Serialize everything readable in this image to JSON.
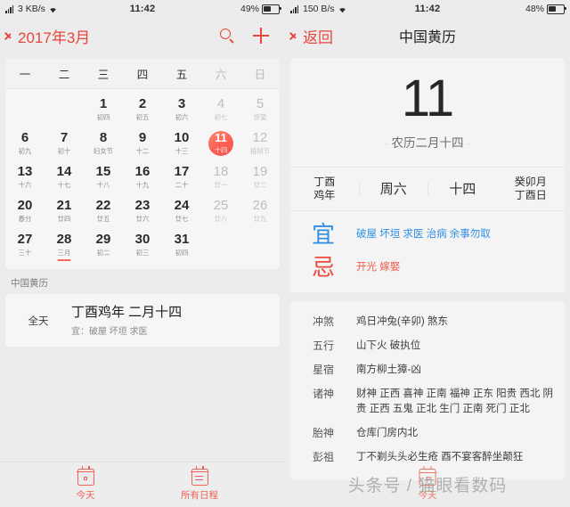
{
  "left": {
    "status": {
      "network": "3 KB/s",
      "time": "11:42",
      "battery": "49%"
    },
    "nav": {
      "title": "2017年3月",
      "search_icon": "search-icon",
      "add_icon": "plus-icon"
    },
    "weekdays": [
      {
        "label": "一",
        "weekend": false
      },
      {
        "label": "二",
        "weekend": false
      },
      {
        "label": "三",
        "weekend": false
      },
      {
        "label": "四",
        "weekend": false
      },
      {
        "label": "五",
        "weekend": false
      },
      {
        "label": "六",
        "weekend": true
      },
      {
        "label": "日",
        "weekend": true
      }
    ],
    "weeks": [
      [
        {
          "num": "",
          "lunar": "",
          "empty": true
        },
        {
          "num": "",
          "lunar": "",
          "empty": true
        },
        {
          "num": "1",
          "lunar": "初四"
        },
        {
          "num": "2",
          "lunar": "初五"
        },
        {
          "num": "3",
          "lunar": "初六"
        },
        {
          "num": "4",
          "lunar": "初七",
          "dim": true
        },
        {
          "num": "5",
          "lunar": "惊蛰",
          "dim": true
        }
      ],
      [
        {
          "num": "6",
          "lunar": "初九"
        },
        {
          "num": "7",
          "lunar": "初十"
        },
        {
          "num": "8",
          "lunar": "妇女节"
        },
        {
          "num": "9",
          "lunar": "十二"
        },
        {
          "num": "10",
          "lunar": "十三"
        },
        {
          "num": "11",
          "lunar": "十四",
          "selected": true
        },
        {
          "num": "12",
          "lunar": "植树节",
          "dim": true
        }
      ],
      [
        {
          "num": "13",
          "lunar": "十六"
        },
        {
          "num": "14",
          "lunar": "十七"
        },
        {
          "num": "15",
          "lunar": "十八"
        },
        {
          "num": "16",
          "lunar": "十九"
        },
        {
          "num": "17",
          "lunar": "二十"
        },
        {
          "num": "18",
          "lunar": "廿一",
          "dim": true
        },
        {
          "num": "19",
          "lunar": "廿二",
          "dim": true
        }
      ],
      [
        {
          "num": "20",
          "lunar": "春分"
        },
        {
          "num": "21",
          "lunar": "廿四"
        },
        {
          "num": "22",
          "lunar": "廿五"
        },
        {
          "num": "23",
          "lunar": "廿六"
        },
        {
          "num": "24",
          "lunar": "廿七"
        },
        {
          "num": "25",
          "lunar": "廿八",
          "dim": true
        },
        {
          "num": "26",
          "lunar": "廿九",
          "dim": true
        }
      ],
      [
        {
          "num": "27",
          "lunar": "三十"
        },
        {
          "num": "28",
          "lunar": "三月",
          "mark": true
        },
        {
          "num": "29",
          "lunar": "初二"
        },
        {
          "num": "30",
          "lunar": "初三"
        },
        {
          "num": "31",
          "lunar": "初四"
        },
        {
          "num": "",
          "lunar": "",
          "empty": true
        },
        {
          "num": "",
          "lunar": "",
          "empty": true
        }
      ]
    ],
    "event_section_label": "中国黄历",
    "event": {
      "allday": "全天",
      "title": "丁酉鸡年 二月十四",
      "sub": "宜：破屋 坏垣 求医"
    },
    "tabs": [
      {
        "label": "今天",
        "icon": "calendar-today-icon"
      },
      {
        "label": "所有日程",
        "icon": "list-schedule-icon"
      }
    ]
  },
  "right": {
    "status": {
      "network": "150 B/s",
      "time": "11:42",
      "battery": "48%"
    },
    "nav": {
      "back": "返回",
      "title": "中国黄历"
    },
    "big_day": "11",
    "big_lunar": "农历二月十四",
    "ganzhi": [
      {
        "line1": "丁酉",
        "line2": "鸡年"
      },
      {
        "line1": "周六",
        "line2": ""
      },
      {
        "line1": "十四",
        "line2": ""
      },
      {
        "line1": "癸卯月",
        "line2": "丁酉日"
      }
    ],
    "yi": {
      "char": "宜",
      "items": "破屋 坏垣 求医 治病 余事勿取"
    },
    "ji": {
      "char": "忌",
      "items": "开光 嫁娶"
    },
    "details": [
      {
        "key": "冲煞",
        "value": "鸡日冲兔(辛卯) 煞东"
      },
      {
        "key": "五行",
        "value": "山下火 破执位"
      },
      {
        "key": "星宿",
        "value": "南方柳土獐-凶"
      },
      {
        "key": "诸神",
        "value": "财神 正西 喜神 正南 福神 正东 阳贵 西北 阴贵 正西 五鬼 正北 生门 正南 死门 正北"
      },
      {
        "key": "胎神",
        "value": "仓库门房内北"
      },
      {
        "key": "彭祖",
        "value": "丁不剃头头必生疮 酉不宴客醉坐颠狂"
      }
    ],
    "ghost_tab_label": "今天",
    "watermark": "头条号 / 猫眼看数码"
  },
  "colors": {
    "accent_red": "#e8453c",
    "tab_red": "#ef6255",
    "yi_blue": "#3190e3",
    "ji_red": "#ef5b4c"
  }
}
